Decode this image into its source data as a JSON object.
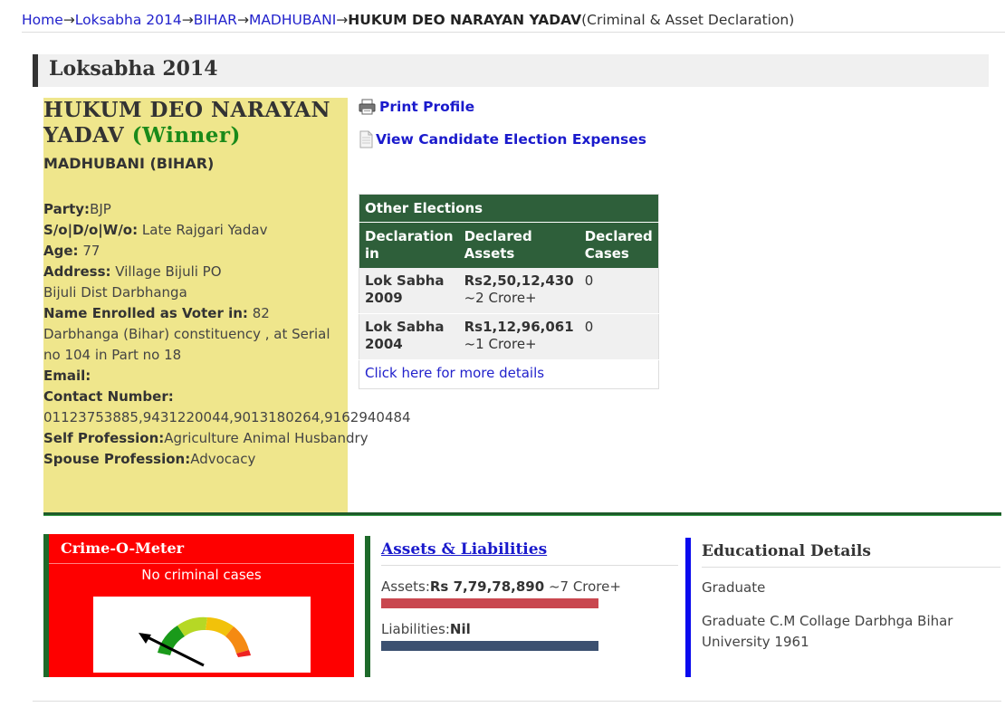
{
  "breadcrumb": {
    "home": "Home",
    "election": "Loksabha 2014",
    "state": "BIHAR",
    "constituency": "MADHUBANI",
    "candidate": "HUKUM DEO NARAYAN YADAV",
    "suffix": "(Criminal & Asset Declaration)",
    "separator": "→"
  },
  "section_title": "Loksabha 2014",
  "candidate": {
    "name": "HUKUM DEO NARAYAN YADAV",
    "status": "(Winner)",
    "constituency": "MADHUBANI (BIHAR)"
  },
  "details": {
    "party_label": "Party:",
    "party": "BJP",
    "relation_label": "S/o|D/o|W/o:",
    "relation": "Late Rajgari Yadav",
    "age_label": "Age:",
    "age": "77",
    "address_label": "Address:",
    "address": "Village Bijuli PO Bijuli Dist Darbhanga",
    "voter_label": "Name Enrolled as Voter in:",
    "voter": "82 Darbhanga (Bihar) constituency , at Serial no 104 in Part no 18",
    "email_label": "Email:",
    "email": "",
    "contact_label": "Contact Number:",
    "contact": "01123753885,9431220044,9013180264,9162940484",
    "self_prof_label": "Self Profession:",
    "self_prof": "Agriculture Animal Husbandry",
    "spouse_prof_label": "Spouse Profession:",
    "spouse_prof": "Advocacy"
  },
  "links": {
    "print": "Print Profile",
    "expenses": "View Candidate Election Expenses"
  },
  "icons": {
    "print": "printer-icon",
    "expenses": "document-icon"
  },
  "other_elections": {
    "caption": "Other Elections",
    "headers": [
      "Declaration in",
      "Declared Assets",
      "Declared Cases"
    ],
    "rows": [
      {
        "election": "Lok Sabha 2009",
        "assets": "Rs2,50,12,430",
        "assets_approx": "~2 Crore+",
        "cases": "0"
      },
      {
        "election": "Lok Sabha 2004",
        "assets": "Rs1,12,96,061",
        "assets_approx": "~1 Crore+",
        "cases": "0"
      }
    ],
    "more_link": "Click here for more details"
  },
  "crime": {
    "title": "Crime-O-Meter",
    "status": "No criminal cases",
    "meter_level": 0
  },
  "assets": {
    "title": "Assets & Liabilities",
    "assets_label": "Assets:",
    "assets_value": "Rs 7,79,78,890",
    "assets_approx": " ~7 Crore+",
    "liabilities_label": "Liabilities:",
    "liabilities_value": "Nil"
  },
  "education": {
    "title": "Educational Details",
    "level": "Graduate",
    "detail": "Graduate C.M Collage Darbhga Bihar University 1961"
  },
  "colors": {
    "candidate_panel": "#efe68c",
    "winner": "#1a8a1a",
    "table_header": "#2e5f3a",
    "crime_box": "#fe0000",
    "assets_bar": "#c9474f",
    "liabilities_bar": "#3b5070",
    "education_accent": "#0a0aee"
  }
}
